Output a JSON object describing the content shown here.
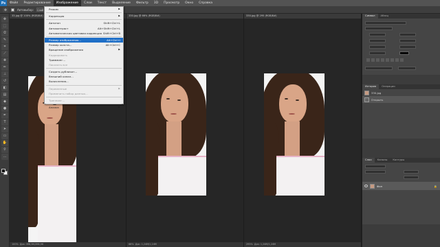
{
  "app": {
    "logo": "Ps"
  },
  "menubar": {
    "items": [
      "Файл",
      "Редактирование",
      "Изображение",
      "Слои",
      "Текст",
      "Выделение",
      "Фильтр",
      "3D",
      "Просмотр",
      "Окно",
      "Справка"
    ],
    "active_index": 2
  },
  "optionsbar": {
    "autoselect": "Автовыбор:",
    "group": "Слой"
  },
  "documents": [
    {
      "tab": "33.jpg @ 100% (RGB/8#)",
      "status": "Док: 396,9К/396,9К"
    },
    {
      "tab": "330.jpg @ 66% (RGB/8#)",
      "status": "Док: 1,24М/1,24М"
    },
    {
      "tab": "330.jpg @ 295 (RGB/8#)",
      "status": "Док: 1,24М/1,24М"
    }
  ],
  "zoom_statuses": [
    "100%",
    "66%",
    "295%"
  ],
  "image_menu": [
    {
      "label": "Режим",
      "shortcut": "",
      "submenu": true,
      "disabled": false
    },
    {
      "sep": true
    },
    {
      "label": "Коррекция",
      "shortcut": "",
      "submenu": true,
      "disabled": false
    },
    {
      "sep": true
    },
    {
      "label": "Автотон",
      "shortcut": "Shift+Ctrl+L",
      "disabled": false
    },
    {
      "label": "Автоконтраст",
      "shortcut": "Alt+Shift+Ctrl+L",
      "disabled": false
    },
    {
      "label": "Автоматическая цветовая коррекция",
      "shortcut": "Shift+Ctrl+B",
      "disabled": false
    },
    {
      "sep": true
    },
    {
      "label": "Размер изображения...",
      "shortcut": "Alt+Ctrl+I",
      "disabled": false,
      "highlight": true
    },
    {
      "label": "Размер холста...",
      "shortcut": "Alt+Ctrl+C",
      "disabled": false
    },
    {
      "label": "Вращение изображения",
      "shortcut": "",
      "submenu": true,
      "disabled": false
    },
    {
      "label": "Кадрировать",
      "shortcut": "",
      "disabled": true
    },
    {
      "label": "Тримминг...",
      "shortcut": "",
      "disabled": false
    },
    {
      "label": "Показать все",
      "shortcut": "",
      "disabled": true
    },
    {
      "sep": true
    },
    {
      "label": "Создать дубликат...",
      "shortcut": "",
      "disabled": false
    },
    {
      "label": "Внешний канал...",
      "shortcut": "",
      "disabled": false
    },
    {
      "label": "Вычисления...",
      "shortcut": "",
      "disabled": false
    },
    {
      "sep": true
    },
    {
      "label": "Переменные",
      "shortcut": "",
      "submenu": true,
      "disabled": true
    },
    {
      "label": "Применить набор данных...",
      "shortcut": "",
      "disabled": true
    },
    {
      "sep": true
    },
    {
      "label": "Треппинг...",
      "shortcut": "",
      "disabled": true
    },
    {
      "sep": true
    },
    {
      "label": "Анализ",
      "shortcut": "",
      "submenu": true,
      "disabled": false
    }
  ],
  "panels": {
    "top_tabs": [
      "Символ",
      "Абзац"
    ],
    "history_tabs": [
      "История",
      "Операции"
    ],
    "history_items": [
      "330.jpg",
      "Открыть"
    ],
    "layers_tabs": [
      "Слои",
      "Каналы",
      "Контуры"
    ],
    "layer_name": "Фон"
  }
}
